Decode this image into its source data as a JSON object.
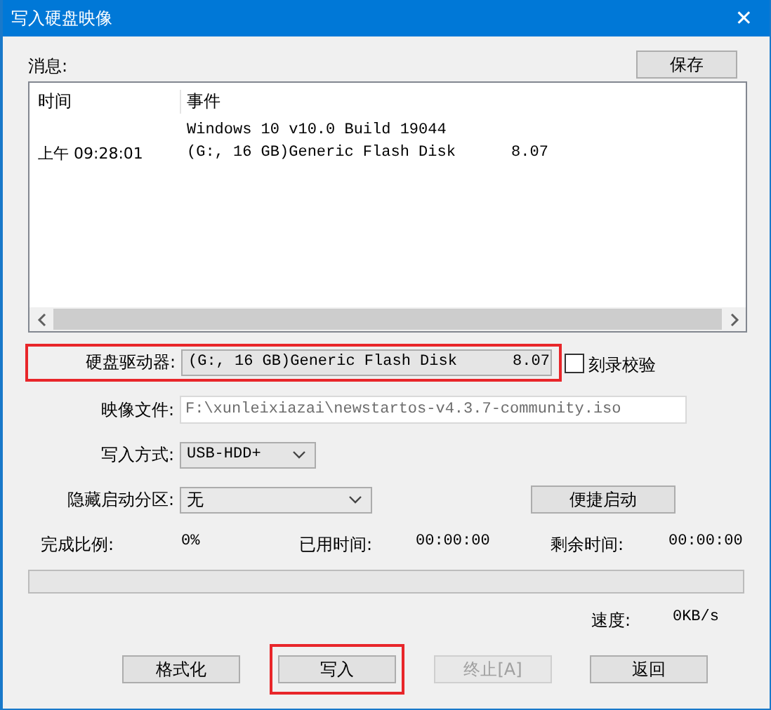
{
  "window": {
    "title": "写入硬盘映像",
    "close": "✕"
  },
  "messages": {
    "label": "消息:",
    "save_button": "保存",
    "columns": [
      "时间",
      "事件"
    ],
    "rows": [
      {
        "time": "",
        "event": "Windows 10 v10.0 Build 19044"
      },
      {
        "time": "上午 09:28:01",
        "event": "(G:, 16 GB)Generic Flash Disk      8.07"
      }
    ]
  },
  "drive": {
    "label": "硬盘驱动器:",
    "value": "(G:, 16 GB)Generic Flash Disk      8.07",
    "highlighted": true
  },
  "verify": {
    "label": "刻录校验",
    "checked": false
  },
  "image_file": {
    "label": "映像文件:",
    "value": "F:\\xunleixiazai\\newstartos-v4.3.7-community.iso"
  },
  "write_mode": {
    "label": "写入方式:",
    "value": "USB-HDD+"
  },
  "hidden_partition": {
    "label": "隐藏启动分区:",
    "value": "无"
  },
  "quick_boot_button": "便捷启动",
  "stats": [
    {
      "label": "完成比例:",
      "value": "0%"
    },
    {
      "label": "已用时间:",
      "value": "00:00:00"
    },
    {
      "label": "剩余时间:",
      "value": "00:00:00"
    }
  ],
  "progress": {
    "level": 0
  },
  "speed": {
    "label": "速度:",
    "value": "0KB/s"
  },
  "buttons": [
    {
      "label": "格式化",
      "disabled": false,
      "highlighted": false
    },
    {
      "label": "写入",
      "disabled": false,
      "highlighted": true
    },
    {
      "label": "终止[A]",
      "disabled": true,
      "highlighted": false
    },
    {
      "label": "返回",
      "disabled": false,
      "highlighted": false
    }
  ]
}
